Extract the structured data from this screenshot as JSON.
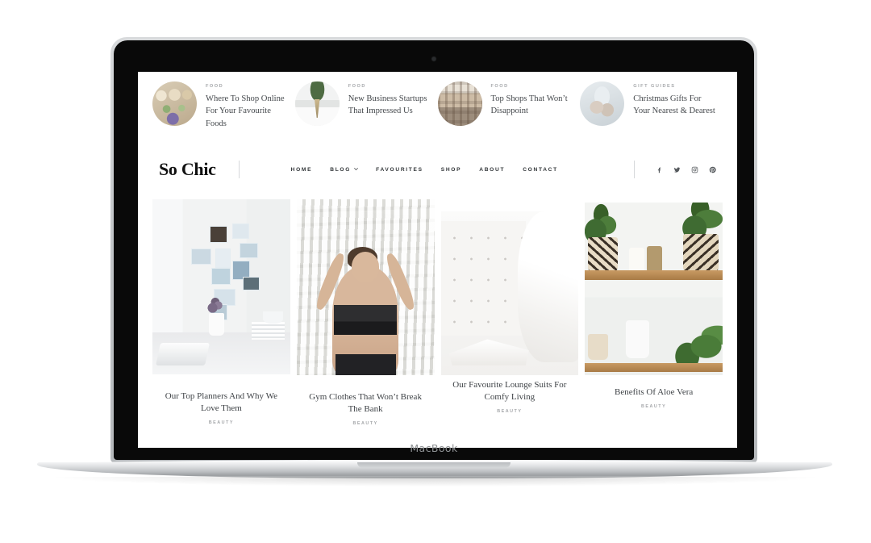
{
  "device": {
    "brand_label": "MacBook",
    "camera_icon": "camera-dot"
  },
  "site": {
    "logo": "So Chic",
    "topbar": [
      {
        "category": "FOOD",
        "title": "Where To Shop Online For Your Favourite Foods",
        "image": "food-bowls-thumbnail"
      },
      {
        "category": "FOOD",
        "title": "New Business Startups That Impressed Us",
        "image": "plant-vase-thumbnail"
      },
      {
        "category": "FOOD",
        "title": "Top Shops That Won’t Disappoint",
        "image": "city-street-thumbnail"
      },
      {
        "category": "GIFT GUIDES",
        "title": "Christmas Gifts For Your Nearest & Dearest",
        "image": "wrapped-gifts-thumbnail"
      }
    ],
    "menu": [
      {
        "label": "HOME",
        "has_dropdown": false
      },
      {
        "label": "BLOG",
        "has_dropdown": true
      },
      {
        "label": "FAVOURITES",
        "has_dropdown": false
      },
      {
        "label": "SHOP",
        "has_dropdown": false
      },
      {
        "label": "ABOUT",
        "has_dropdown": false
      },
      {
        "label": "CONTACT",
        "has_dropdown": false
      }
    ],
    "socials": [
      {
        "name": "facebook-icon"
      },
      {
        "name": "twitter-icon"
      },
      {
        "name": "instagram-icon"
      },
      {
        "name": "pinterest-icon"
      }
    ],
    "posts": [
      {
        "title": "Our Top Planners And Why We Love Them",
        "category": "BEAUTY",
        "image": "white-desk-photo-wall"
      },
      {
        "title": "Gym Clothes That Won’t Break The Bank",
        "category": "BEAUTY",
        "image": "woman-activewear-building"
      },
      {
        "title": "Our Favourite Lounge Suits For Comfy Living",
        "category": "BEAUTY",
        "image": "white-tufted-sofa-blanket"
      },
      {
        "title": "Benefits Of Aloe Vera",
        "category": "BEAUTY",
        "image": "shelf-with-potted-plants"
      }
    ]
  },
  "colors": {
    "text_dark": "#3f4347",
    "logo": "#111111",
    "category_grey": "#a6a8ab",
    "nav_text": "#2f3336",
    "page_bg": "#ffffff",
    "bezel": "#090909",
    "chassis": "#c2c5c8"
  }
}
